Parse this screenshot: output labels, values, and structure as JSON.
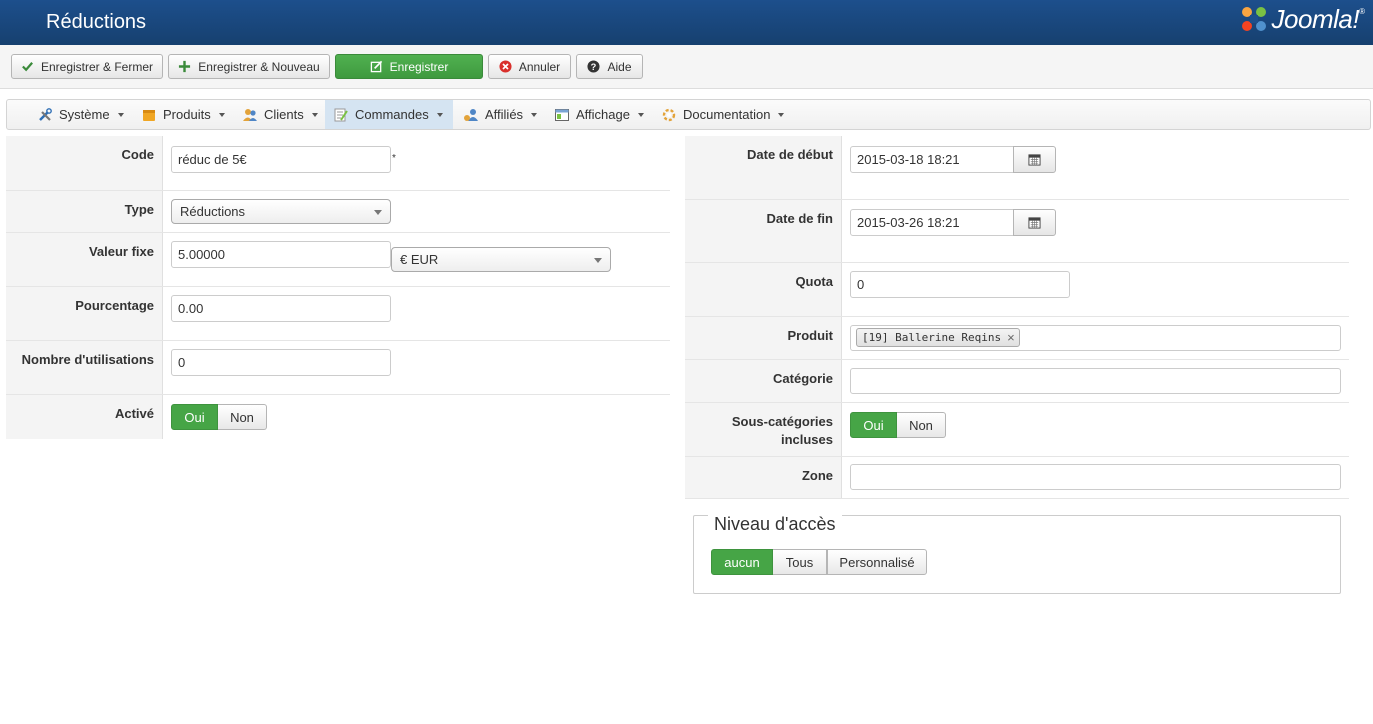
{
  "header": {
    "title": "Réductions",
    "logo_text": "Joomla!",
    "logo_reg": "®"
  },
  "toolbar": {
    "save_close": "Enregistrer & Fermer",
    "save_new": "Enregistrer & Nouveau",
    "save": "Enregistrer",
    "cancel": "Annuler",
    "help": "Aide"
  },
  "menu": {
    "items": [
      {
        "label": "Système",
        "icon": "tools-icon"
      },
      {
        "label": "Produits",
        "icon": "box-icon"
      },
      {
        "label": "Clients",
        "icon": "users-icon"
      },
      {
        "label": "Commandes",
        "icon": "orders-icon"
      },
      {
        "label": "Affiliés",
        "icon": "affiliates-icon"
      },
      {
        "label": "Affichage",
        "icon": "display-icon"
      },
      {
        "label": "Documentation",
        "icon": "help-icon"
      }
    ]
  },
  "left_form": {
    "code": {
      "label": "Code",
      "value": "réduc de 5€",
      "required_mark": "*"
    },
    "type": {
      "label": "Type",
      "value": "Réductions"
    },
    "fixed_value": {
      "label": "Valeur fixe",
      "value": "5.00000",
      "currency": "€ EUR"
    },
    "percentage": {
      "label": "Pourcentage",
      "value": "0.00"
    },
    "uses": {
      "label": "Nombre d'utilisations",
      "value": "0"
    },
    "active": {
      "label": "Activé",
      "yes": "Oui",
      "no": "Non",
      "selected": "Oui"
    }
  },
  "right_form": {
    "start_date": {
      "label": "Date de début",
      "value": "2015-03-18 18:21"
    },
    "end_date": {
      "label": "Date de fin",
      "value": "2015-03-26 18:21"
    },
    "quota": {
      "label": "Quota",
      "value": "0"
    },
    "product": {
      "label": "Produit",
      "tag": "[19] Ballerine Reqins",
      "remove": "×"
    },
    "category": {
      "label": "Catégorie",
      "value": ""
    },
    "subcategories": {
      "label": "Sous-catégories incluses",
      "yes": "Oui",
      "no": "Non",
      "selected": "Oui"
    },
    "zone": {
      "label": "Zone",
      "value": ""
    }
  },
  "access": {
    "legend": "Niveau d'accès",
    "options": [
      "aucun",
      "Tous",
      "Personnalisé"
    ],
    "selected": "aucun"
  },
  "colors": {
    "header": "#1d4f8c",
    "green": "#46a546",
    "active_menu": "#d5e4f2"
  }
}
